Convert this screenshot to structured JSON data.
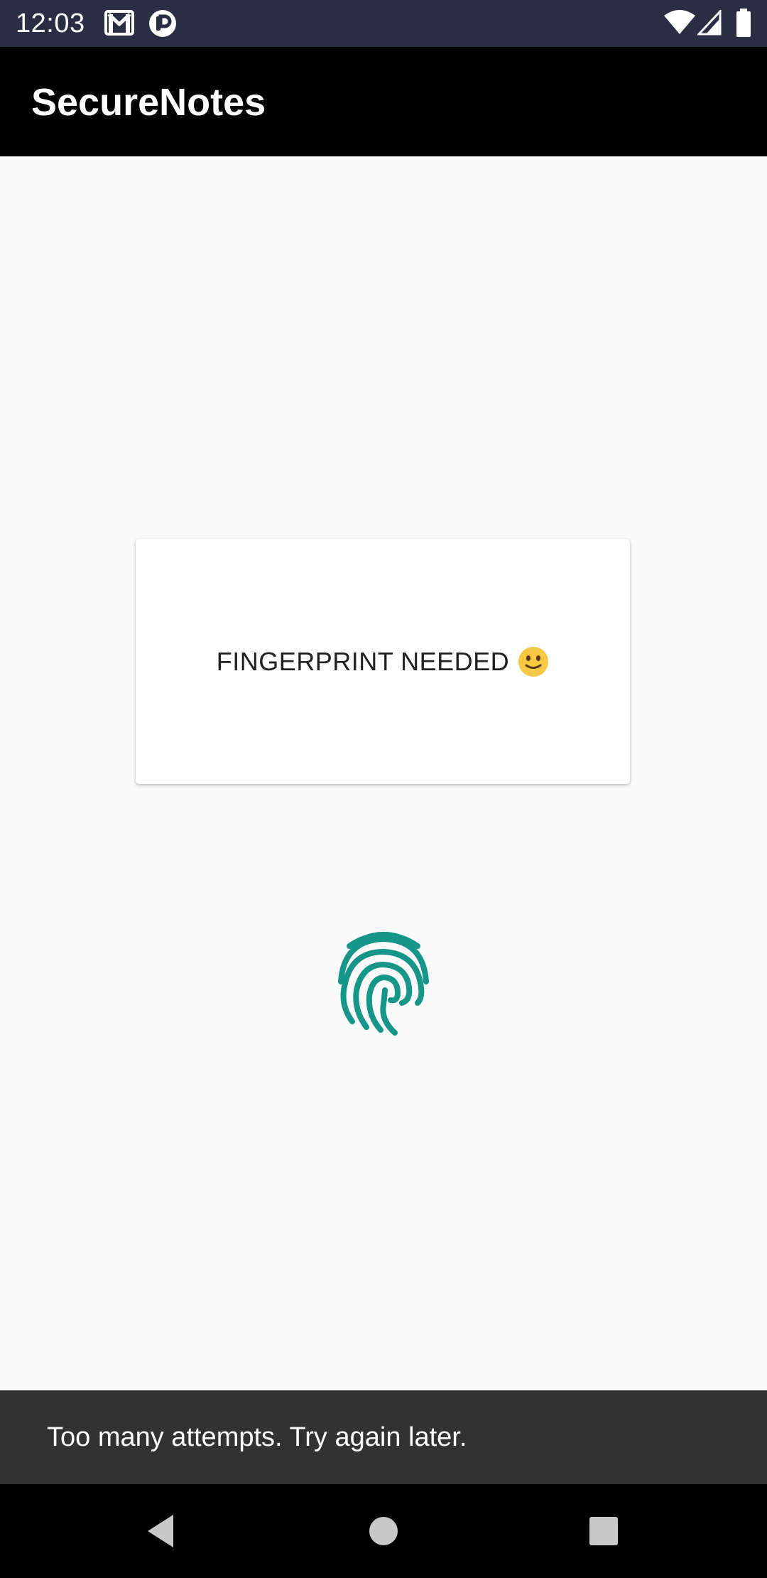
{
  "status_bar": {
    "time": "12:03",
    "icons": [
      "gmail-icon",
      "app-notification-icon",
      "wifi-icon",
      "cell-signal-icon",
      "battery-icon"
    ]
  },
  "app_bar": {
    "title": "SecureNotes"
  },
  "card": {
    "message": "FINGERPRINT NEEDED",
    "emoji_icon": "slightly-smiling-face-icon"
  },
  "fingerprint": {
    "icon": "fingerprint-icon",
    "color": "#159688"
  },
  "snackbar": {
    "message": "Too many attempts. Try again later."
  },
  "nav_bar": {
    "buttons": [
      "back-icon",
      "home-icon",
      "recents-icon"
    ]
  },
  "colors": {
    "status_bar": "#2a2e45",
    "app_bar": "#000000",
    "background": "#fafafa",
    "snackbar": "#323232",
    "accent": "#159688"
  }
}
